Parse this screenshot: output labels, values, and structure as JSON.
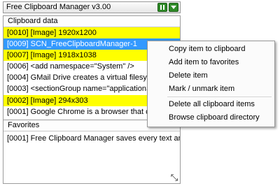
{
  "window": {
    "title": "Free Clipboard Manager v3.00",
    "colors": {
      "title_buttons": "#2f8a28",
      "highlight": "#ffff00",
      "selection": "#3399ff"
    },
    "buttons": [
      {
        "icon": "pause-icon"
      },
      {
        "icon": "dropdown-arrow-icon"
      }
    ]
  },
  "clipboard": {
    "header": "Clipboard data",
    "items": [
      {
        "text": "[0010] [Image] 1920x1200",
        "state": "highlighted"
      },
      {
        "text": "[0009] SCN_FreeClipboardManager-1",
        "state": "selected"
      },
      {
        "text": "[0007] [Image] 1918x1038",
        "state": "highlighted"
      },
      {
        "text": "[0006] <add namespace=\"System\" />          <a",
        "state": "normal"
      },
      {
        "text": "[0004] GMail Drive creates a virtual filesystem aro",
        "state": "normal"
      },
      {
        "text": "[0003] <sectionGroup name=\"applicationSettings",
        "state": "normal"
      },
      {
        "text": "[0002] [Image] 294x303",
        "state": "highlighted"
      },
      {
        "text": "[0001] Google Chrome is a browser that combine",
        "state": "normal"
      }
    ]
  },
  "favorites": {
    "header": "Favorites",
    "items": [
      {
        "text": "[0001] Free Clipboard Manager saves every text and i..."
      }
    ]
  },
  "context_menu": {
    "items": [
      "Copy item to clipboard",
      "Add item to favorites",
      "Delete item",
      "Mark / unmark item",
      "Delete all clipboard items",
      "Browse clipboard directory"
    ]
  }
}
